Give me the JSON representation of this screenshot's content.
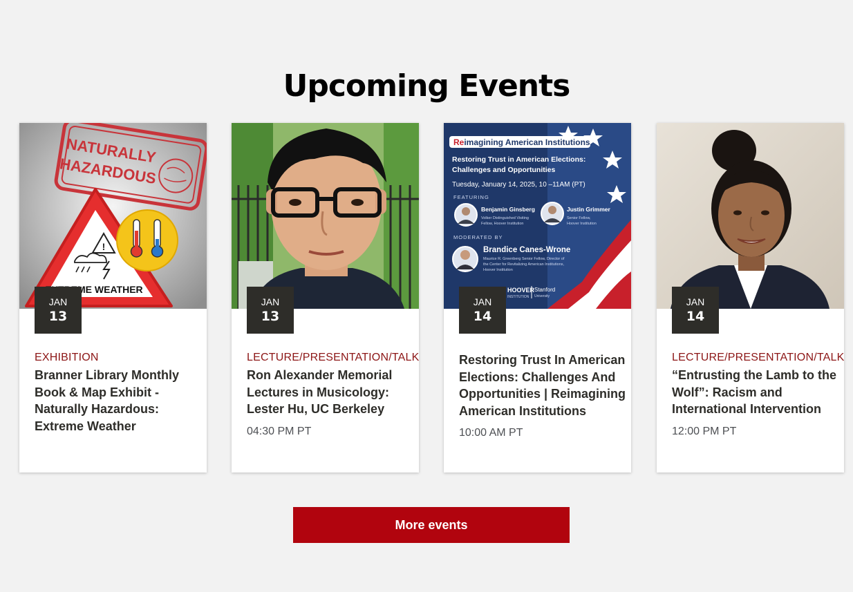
{
  "page_title": "Upcoming Events",
  "events": [
    {
      "month": "JAN",
      "day": "13",
      "category": "EXHIBITION",
      "title": "Branner Library Monthly Book & Map Exhibit - Naturally Hazardous: Extreme Weather",
      "time": "",
      "image": {
        "stamp_line1": "NATURALLY",
        "stamp_line2": "HAZARDOUS",
        "sign_text": "EXTREME WEATHER"
      }
    },
    {
      "month": "JAN",
      "day": "13",
      "category": "LECTURE/PRESENTATION/TALK",
      "title": "Ron Alexander Memorial Lectures in Musicology: Lester Hu, UC Berkeley",
      "time": "04:30 PM PT",
      "image": {}
    },
    {
      "month": "JAN",
      "day": "14",
      "category": "",
      "title": "Restoring Trust In American Elections: Challenges And Opportunities | Reimagining American Institutions",
      "time": "10:00 AM PT",
      "image": {
        "series_prefix": "Re",
        "series_rest": "imagining American Institutions",
        "headline_line1": "Restoring Trust in American Elections:",
        "headline_line2": "Challenges and Opportunities",
        "date_line": "Tuesday, January 14, 2025, 10 –11AM (PT)",
        "featuring_label": "FEATURING",
        "speaker1_name": "Benjamin Ginsberg",
        "speaker1_role1": "Volker Distinguished Visiting",
        "speaker1_role2": "Fellow, Hoover Institution",
        "speaker2_name": "Justin Grimmer",
        "speaker2_role1": "Senior Fellow,",
        "speaker2_role2": "Hoover Institution",
        "moderated_label": "MODERATED BY",
        "moderator_name": "Brandice Canes-Wrone",
        "moderator_role1": "Maurice R. Greenberg Senior Fellow, Director of",
        "moderator_role2": "the Center for Revitalizing American Institutions,",
        "moderator_role3": "Hoover Institution",
        "logo_hoover": "HOOVER",
        "logo_institution": "INSTITUTION",
        "logo_stanford": "Stanford",
        "logo_university": "University"
      }
    },
    {
      "month": "JAN",
      "day": "14",
      "category": "LECTURE/PRESENTATION/TALK",
      "title": "“Entrusting the Lamb to the Wolf”: Racism and International Intervention",
      "time": "12:00 PM PT",
      "image": {}
    }
  ],
  "more_button_label": "More events",
  "colors": {
    "cardinal_red": "#8c1515",
    "button_red": "#b1040e",
    "badge_dark": "#2e2d29",
    "background": "#f2f2f2"
  }
}
